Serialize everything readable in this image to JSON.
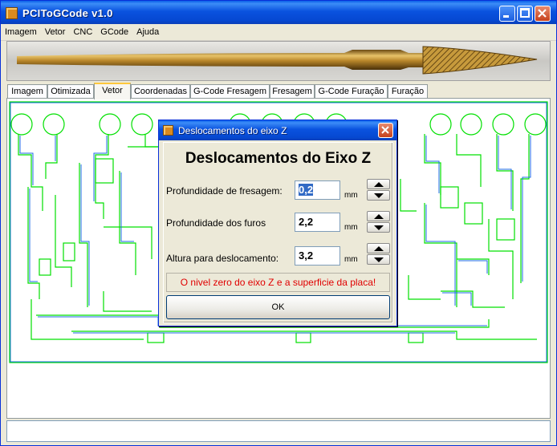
{
  "window": {
    "title": "PCIToGCode  v1.0"
  },
  "menu": [
    "Imagem",
    "Vetor",
    "CNC",
    "GCode",
    "Ajuda"
  ],
  "tabs": [
    "Imagem",
    "Otimizada",
    "Vetor",
    "Coordenadas",
    "G-Code Fresagem",
    "Fresagem",
    "G-Code Furação",
    "Furação"
  ],
  "active_tab": "Vetor",
  "dialog": {
    "title": "Deslocamentos do eixo Z",
    "heading": "Deslocamentos do Eixo Z",
    "fields": [
      {
        "label": "Profundidade de fresagem:",
        "value": "0,2",
        "unit": "mm"
      },
      {
        "label": "Profundidade dos furos",
        "value": "2,2",
        "unit": "mm"
      },
      {
        "label": "Altura para  deslocamento:",
        "value": "3,2",
        "unit": "mm"
      }
    ],
    "notice": "O nivel zero do eixo Z e a superficie da placa!",
    "ok_label": "OK"
  },
  "colors": {
    "trace_green": "#00E000",
    "trace_blue": "#1E6BE6",
    "notice_red": "#E00000"
  }
}
